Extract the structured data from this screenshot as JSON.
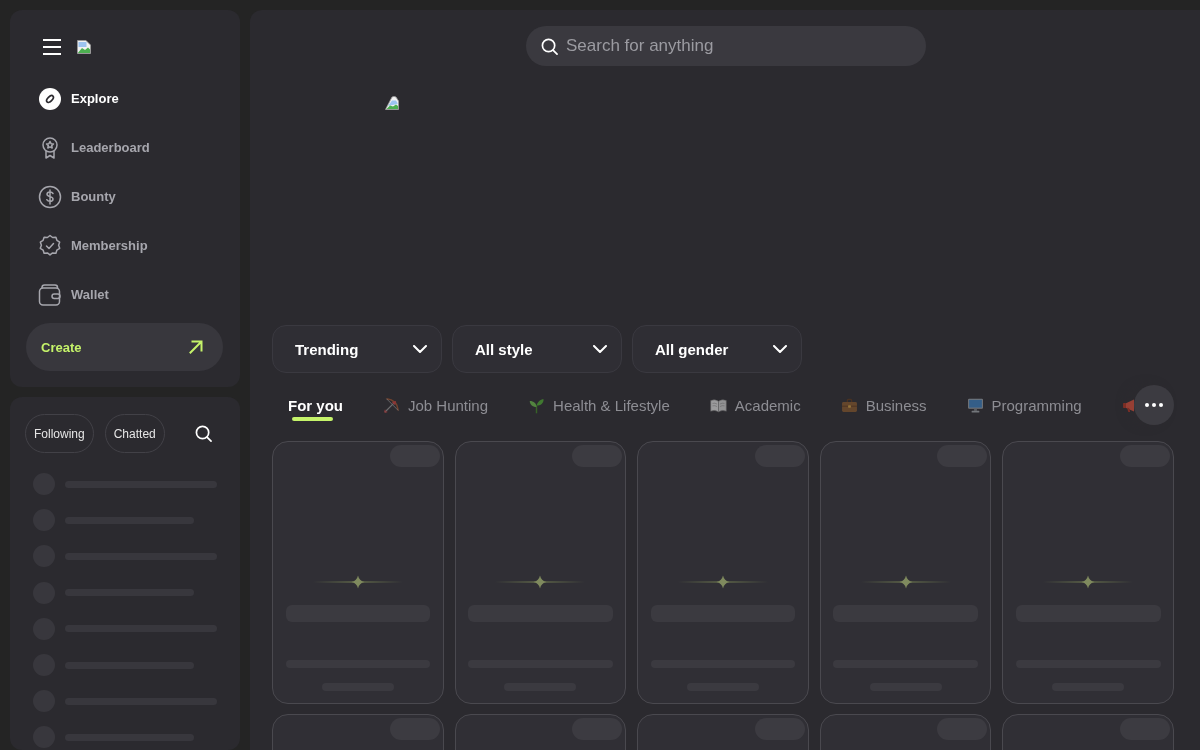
{
  "sidebar": {
    "nav": [
      {
        "label": "Explore",
        "selected": true
      },
      {
        "label": "Leaderboard",
        "selected": false
      },
      {
        "label": "Bounty",
        "selected": false
      },
      {
        "label": "Membership",
        "selected": false
      },
      {
        "label": "Wallet",
        "selected": false
      }
    ],
    "create_button": {
      "label": "Create"
    }
  },
  "chat_panel": {
    "filters": [
      {
        "label": "Following",
        "selected": false
      },
      {
        "label": "Chatted",
        "selected": false
      }
    ],
    "placeholder_rows": [
      {
        "kind": "long"
      },
      {
        "kind": "short"
      },
      {
        "kind": "long"
      },
      {
        "kind": "short"
      },
      {
        "kind": "long"
      },
      {
        "kind": "short"
      },
      {
        "kind": "long"
      },
      {
        "kind": "short"
      }
    ]
  },
  "search": {
    "placeholder": "Search for anything"
  },
  "sort_dropdowns": [
    {
      "value": "Trending"
    },
    {
      "value": "All style"
    },
    {
      "value": "All gender"
    }
  ],
  "category_tabs": [
    {
      "label": "For you",
      "selected": true
    },
    {
      "label": "Job Hunting",
      "selected": false
    },
    {
      "label": "Health & Lifestyle",
      "selected": false
    },
    {
      "label": "Academic",
      "selected": false
    },
    {
      "label": "Business",
      "selected": false
    },
    {
      "label": "Programming",
      "selected": false
    },
    {
      "selected": false
    }
  ],
  "cards": [
    {
      "kind": "skeleton"
    },
    {
      "kind": "skeleton"
    },
    {
      "kind": "skeleton"
    },
    {
      "kind": "skeleton"
    },
    {
      "kind": "skeleton"
    },
    {
      "kind": "skeleton"
    },
    {
      "kind": "skeleton"
    },
    {
      "kind": "skeleton"
    },
    {
      "kind": "skeleton"
    },
    {
      "kind": "skeleton"
    }
  ]
}
